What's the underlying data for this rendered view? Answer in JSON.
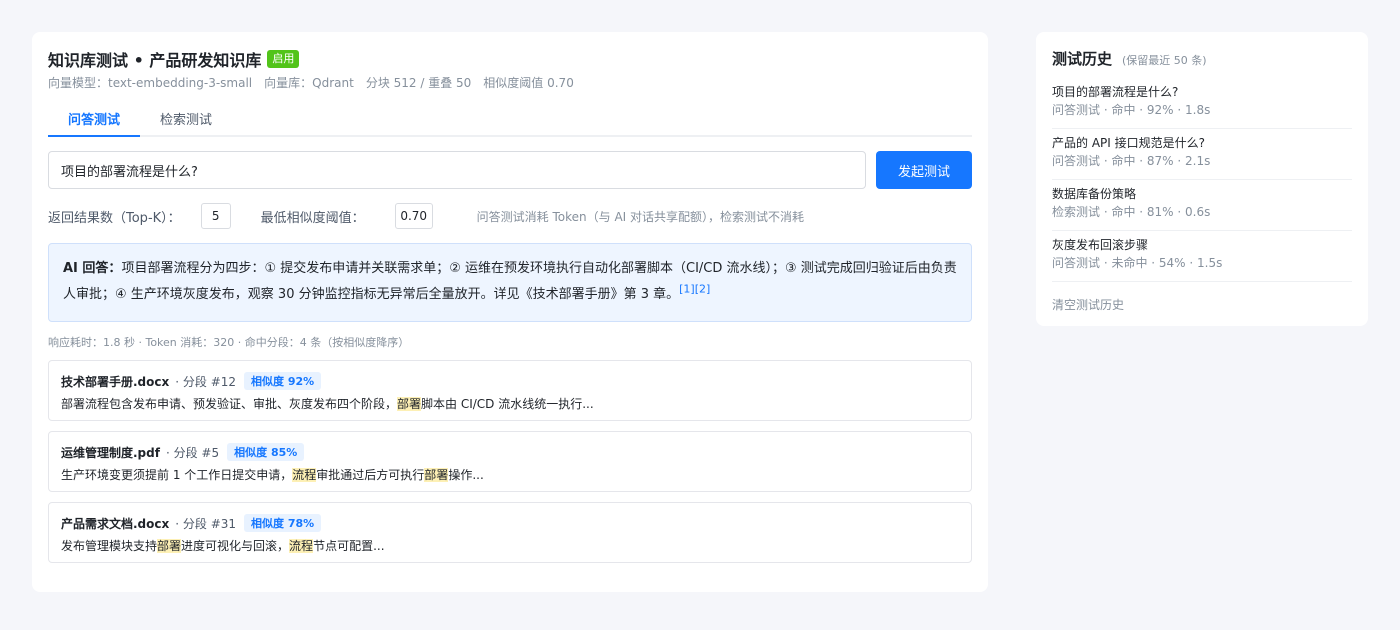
{
  "kb": {
    "title": "知识库测试 • 产品研发知识库",
    "status": "启用",
    "meta": [
      "向量模型：text-embedding-3-small",
      "向量库：Qdrant",
      "分块 512 / 重叠 50",
      "相似度阈值 0.70"
    ]
  },
  "tabs": [
    {
      "label": "问答测试",
      "active": true
    },
    {
      "label": "检索测试",
      "active": false
    }
  ],
  "query": {
    "value": "项目的部署流程是什么?",
    "button": "发起测试"
  },
  "params": {
    "topk_label": "返回结果数（Top-K）：",
    "topk_value": "5",
    "threshold_label": "最低相似度阈值：",
    "threshold_value": "0.70",
    "note": "问答测试消耗 Token（与 AI 对话共享配额），检索测试不消耗"
  },
  "answer": {
    "label": "AI 回答：",
    "text": "项目部署流程分为四步：① 提交发布申请并关联需求单；② 运维在预发环境执行自动化部署脚本（CI/CD 流水线）；③ 测试完成回归验证后由负责人审批；④ 生产环境灰度发布，观察 30 分钟监控指标无异常后全量放开。详见《技术部署手册》第 3 章。",
    "citations": "[1][2]"
  },
  "stats": "响应耗时：1.8 秒   ·   Token 消耗：320   ·   命中分段：4 条（按相似度降序）",
  "segments": [
    {
      "file": "技术部署手册.docx",
      "num": "· 分段 #12",
      "score": "相似度 92%",
      "text_parts": [
        "部署流程包含发布申请、预发验证、审批、灰度发布四个阶段，",
        "部署",
        "脚本由 CI/CD 流水线统一执行..."
      ]
    },
    {
      "file": "运维管理制度.pdf",
      "num": "· 分段 #5",
      "score": "相似度 85%",
      "text_parts": [
        "生产环境变更须提前 1 个工作日提交申请，",
        "流程",
        "审批通过后方可执行",
        "部署",
        "操作..."
      ]
    },
    {
      "file": "产品需求文档.docx",
      "num": "· 分段 #31",
      "score": "相似度 78%",
      "text_parts": [
        "发布管理模块支持",
        "部署",
        "进度可视化与回滚，",
        "流程",
        "节点可配置..."
      ]
    }
  ],
  "history": {
    "title": "测试历史",
    "subtitle": "(保留最近 50 条)",
    "items": [
      {
        "q": "项目的部署流程是什么?",
        "meta": "问答测试 · 命中 · 92% · 1.8s"
      },
      {
        "q": "产品的 API 接口规范是什么?",
        "meta": "问答测试 · 命中 · 87% · 2.1s"
      },
      {
        "q": "数据库备份策略",
        "meta": "检索测试 · 命中 · 81% · 0.6s"
      },
      {
        "q": "灰度发布回滚步骤",
        "meta": "问答测试 · 未命中 · 54% · 1.5s"
      }
    ],
    "clear": "清空测试历史"
  },
  "colors": {
    "accent": "#1677ff",
    "status": "#52c41a",
    "highlight": "#fdf0b5"
  }
}
